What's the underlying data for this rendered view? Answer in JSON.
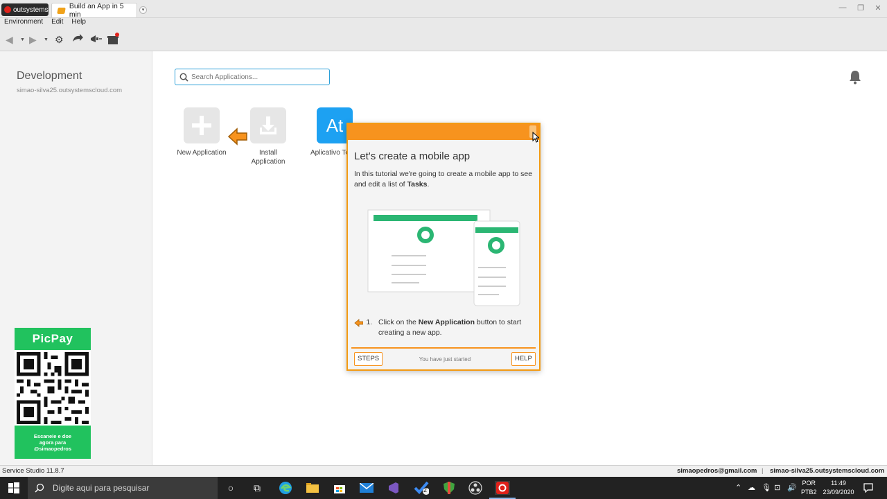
{
  "titlebar": {
    "brand": "outsystems",
    "tab_title": "Build an App in 5 min",
    "controls": [
      "—",
      "❐",
      "✕"
    ]
  },
  "menu": [
    "Environment",
    "Edit",
    "Help"
  ],
  "environment": {
    "title": "Development",
    "host": "simao-silva25.outsystemscloud.com"
  },
  "search": {
    "placeholder": "Search Applications..."
  },
  "apps": [
    {
      "label_lines": [
        "New Application"
      ],
      "icon": "plus-icon"
    },
    {
      "label_lines": [
        "Install",
        "Application"
      ],
      "icon": "download-icon"
    },
    {
      "label": "Aplicativo Te",
      "tile_text": "At",
      "color": "#1da1f2"
    }
  ],
  "tutorial": {
    "title": "Let's create a mobile app",
    "intro_prefix": "In this tutorial we're going to create a mobile app to see and edit a list of ",
    "intro_bold": "Tasks",
    "intro_suffix": ".",
    "step_number": "1.",
    "step_prefix": "Click on the ",
    "step_bold": "New Application",
    "step_suffix": " button to start creating a new app.",
    "steps_button": "STEPS",
    "help_button": "HELP",
    "status": "You have just started"
  },
  "picpay": {
    "brand": "PicPay",
    "caption_lines": [
      "Escaneie e doe",
      "agora para",
      "@simaopedros"
    ]
  },
  "statusbar": {
    "version": "Service Studio 11.8.7",
    "email": "simaopedros@gmail.com",
    "separator": "|",
    "host": "simao-silva25.outsystemscloud.com"
  },
  "taskbar": {
    "search_placeholder": "Digite aqui para pesquisar",
    "badge_count": "2",
    "lang_top": "POR",
    "lang_bottom": "PTB2",
    "time": "11:49",
    "date": "23/09/2020"
  },
  "colors": {
    "accent_orange": "#f7931e",
    "picpay_green": "#21c25e",
    "search_border": "#2a9fd8"
  }
}
